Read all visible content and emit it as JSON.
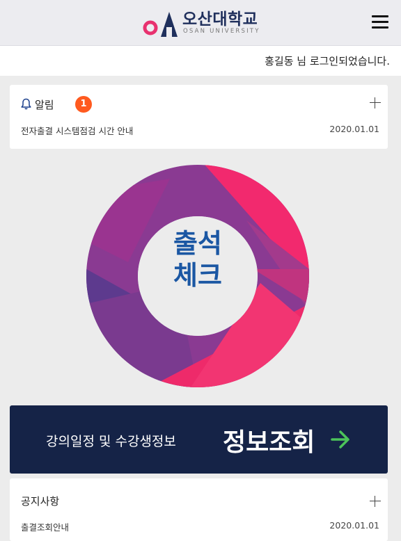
{
  "header": {
    "logo_korean": "오산대학교",
    "logo_english": "OSAN UNIVERSITY",
    "menu_icon": "hamburger-menu-icon"
  },
  "login": {
    "message": "홍길동 님 로그인되었습니다."
  },
  "alarm": {
    "label": "알림",
    "count": "1",
    "icon": "bell-icon",
    "items": [
      {
        "title": "전자출결 시스템점검 시간 안내",
        "date": "2020.01.01"
      }
    ]
  },
  "attendance": {
    "line1": "출석",
    "line2": "체크"
  },
  "info": {
    "subtitle": "강의일정 및 수강생정보",
    "title": "정보조회",
    "icon": "arrow-right-icon"
  },
  "notice": {
    "label": "공지사항",
    "items": [
      {
        "title": "출결조회안내",
        "date": "2020.01.01"
      }
    ]
  },
  "colors": {
    "brand_navy": "#152347",
    "brand_pink": "#e8316f",
    "brand_purple": "#7b3a8c",
    "badge": "#ff5a1f",
    "accent_green": "#4cc35a",
    "attend_text": "#1b57a3"
  }
}
